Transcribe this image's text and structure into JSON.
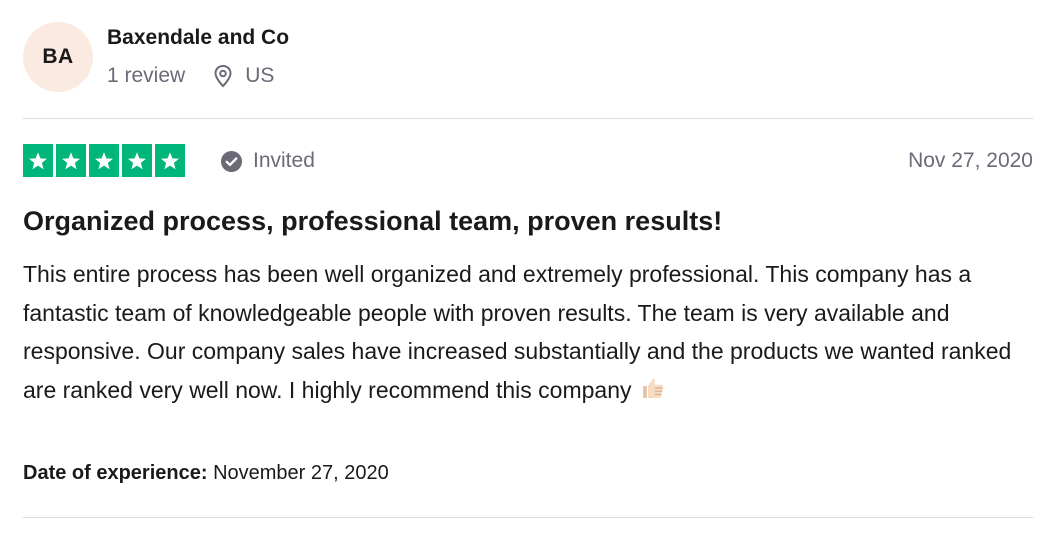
{
  "reviewer": {
    "initials": "BA",
    "name": "Baxendale and Co",
    "review_count": "1 review",
    "location_icon": "map-pin-icon",
    "country": "US"
  },
  "rating": {
    "stars": 5,
    "max_stars": 5,
    "star_color": "#00b67a",
    "verification_icon": "check-circle-icon",
    "verification_label": "Invited",
    "date": "Nov 27, 2020"
  },
  "review": {
    "title": "Organized process, professional team, proven results!",
    "body": "This entire process has been well organized and extremely professional. This company has a fantastic team of knowledgeable people with proven results. The team is very available and responsive. Our company sales have increased substantially and the products we wanted ranked are ranked very well now. I highly recommend this company",
    "emoji_icon": "thumbs-up-icon",
    "experience_label": "Date of experience:",
    "experience_date": "November 27, 2020"
  },
  "colors": {
    "avatar_bg": "#fbeae1",
    "muted_text": "#6b6b78",
    "divider": "#d9d9de"
  }
}
